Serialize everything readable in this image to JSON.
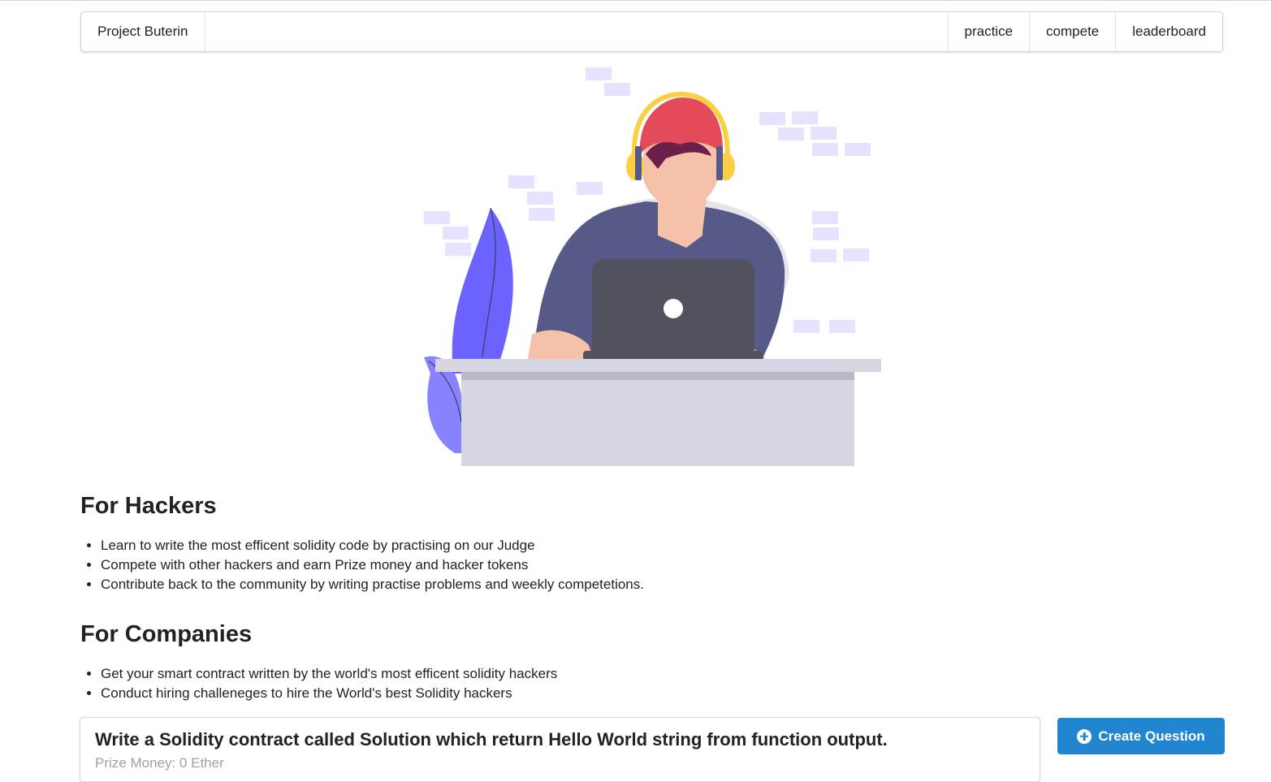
{
  "nav": {
    "brand": "Project Buterin",
    "items": [
      {
        "label": "practice"
      },
      {
        "label": "compete"
      },
      {
        "label": "leaderboard"
      }
    ]
  },
  "hackers": {
    "title": "For Hackers",
    "bullets": [
      "Learn to write the most efficent solidity code by practising on our Judge",
      "Compete with other hackers and earn Prize money and hacker tokens",
      "Contribute back to the community by writing practise problems and weekly competetions."
    ]
  },
  "companies": {
    "title": "For Companies",
    "bullets": [
      "Get your smart contract written by the world's most efficent solidity hackers",
      "Conduct hiring challeneges to hire the World's best Solidity hackers"
    ]
  },
  "question": {
    "title": "Write a Solidity contract called Solution which return Hello World string from function output.",
    "prize": "Prize Money: 0 Ether"
  },
  "create_button": {
    "label": "Create Question",
    "icon": "plus-circle-icon"
  },
  "colors": {
    "primary_button": "#2185d0",
    "illustration_accent": "#6c63ff",
    "cap": "#e34b5b",
    "headphones": "#f9d041",
    "shirt": "#575a89",
    "laptop": "#52525e",
    "desk": "#d6d6e3",
    "blocks": "#e5e3ff"
  }
}
